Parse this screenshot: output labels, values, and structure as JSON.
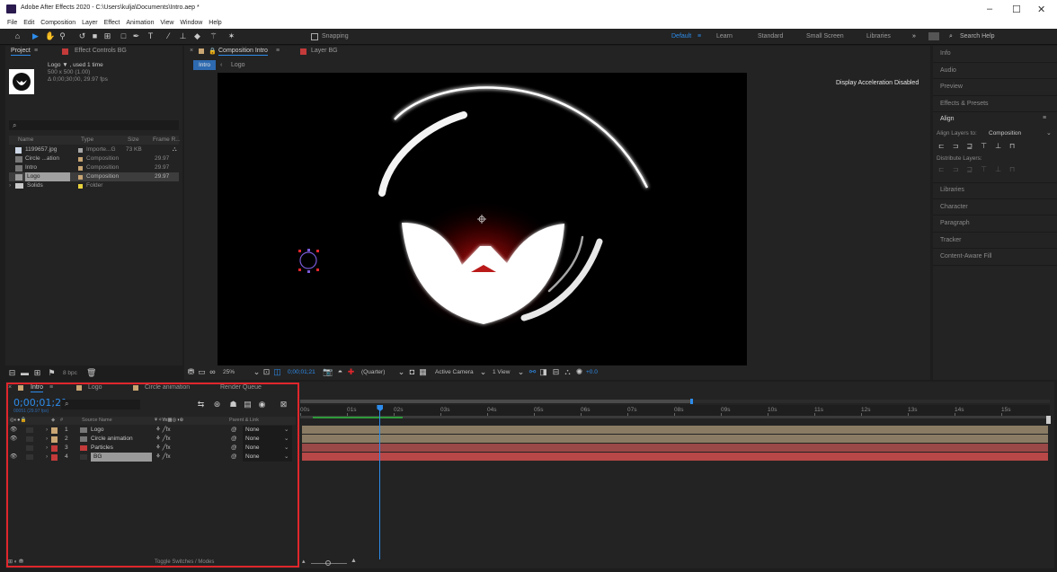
{
  "window": {
    "title": "Adobe After Effects 2020 - C:\\Users\\kulja\\Documents\\Intro.aep *",
    "minimize": "–",
    "maximize": "☐",
    "close": "✕"
  },
  "menu": [
    "File",
    "Edit",
    "Composition",
    "Layer",
    "Effect",
    "Animation",
    "View",
    "Window",
    "Help"
  ],
  "toolbar": {
    "snapping": "Snapping",
    "workspaces": [
      "Default",
      "Learn",
      "Standard",
      "Small Screen",
      "Libraries"
    ],
    "active_workspace": "Default",
    "search_placeholder": "Search Help"
  },
  "project": {
    "tab_project": "Project",
    "tab_effect_controls": "Effect Controls BG",
    "selected_name": "Logo ▼ , used 1 time",
    "selected_size": "500 x 500 (1.00)",
    "selected_duration": "Δ 0;00;30;00, 29.97 fps",
    "columns": [
      "Name",
      "Type",
      "Size",
      "Frame R..."
    ],
    "items": [
      {
        "name": "1199657.jpg",
        "type": "Importe...G",
        "size": "73 KB",
        "fps": "",
        "color": "#a7a7a7"
      },
      {
        "name": "Circle ...ation",
        "type": "Composition",
        "size": "",
        "fps": "29.97",
        "color": "#c9a673"
      },
      {
        "name": "Intro",
        "type": "Composition",
        "size": "",
        "fps": "29.97",
        "color": "#c9a673"
      },
      {
        "name": "Logo",
        "type": "Composition",
        "size": "",
        "fps": "29.97",
        "color": "#c9a673"
      },
      {
        "name": "Solids",
        "type": "Folder",
        "size": "",
        "fps": "",
        "color": "#e8d23c"
      }
    ],
    "bpc": "8 bpc"
  },
  "composition": {
    "tab_comp": "Composition Intro",
    "tab_layer": "Layer BG",
    "crumb_intro": "Intro",
    "crumb_logo": "Logo",
    "notice": "Display Acceleration Disabled",
    "zoom": "25%",
    "timecode": "0;00;01;21",
    "resolution": "(Quarter)",
    "camera": "Active Camera",
    "views": "1 View",
    "exposure": "+0.0"
  },
  "right_panel": {
    "items": [
      "Info",
      "Audio",
      "Preview",
      "Effects & Presets"
    ],
    "align_title": "Align",
    "align_to_label": "Align Layers to:",
    "align_to_value": "Composition",
    "distribute_label": "Distribute Layers:",
    "more": [
      "Libraries",
      "Character",
      "Paragraph",
      "Tracker",
      "Content-Aware Fill"
    ]
  },
  "timeline": {
    "tabs": [
      {
        "label": "Intro",
        "color": "#c9a673"
      },
      {
        "label": "Logo",
        "color": "#c9a673"
      },
      {
        "label": "Circle animation",
        "color": "#c9a673"
      },
      {
        "label": "Render Queue",
        "color": ""
      }
    ],
    "timecode": "0;00;01;21",
    "timecode_sub": "00051 (29.97 fps)",
    "col_source": "Source Name",
    "col_parent": "Parent & Link",
    "layers": [
      {
        "num": "1",
        "name": "Logo",
        "parent": "None",
        "label_color": "#c9a673",
        "bar_color": "#8a7c64"
      },
      {
        "num": "2",
        "name": "Circle animation",
        "parent": "None",
        "label_color": "#c9a673",
        "bar_color": "#8a7c64"
      },
      {
        "num": "3",
        "name": "Particles",
        "parent": "None",
        "label_color": "#c33a3a",
        "bar_color": "#9a4848"
      },
      {
        "num": "4",
        "name": "BG",
        "parent": "None",
        "label_color": "#c33a3a",
        "bar_color": "#b84747"
      }
    ],
    "ruler": [
      "00s",
      "01s",
      "02s",
      "03s",
      "04s",
      "05s",
      "06s",
      "07s",
      "08s",
      "09s",
      "10s",
      "11s",
      "12s",
      "13s",
      "14s",
      "15s"
    ],
    "toggle_label": "Toggle Switches / Modes",
    "playhead_seconds": 1.7,
    "duration_seconds": 15.5
  },
  "colors": {
    "accent_blue": "#2d8ceb",
    "highlight_red": "#e0262c"
  }
}
